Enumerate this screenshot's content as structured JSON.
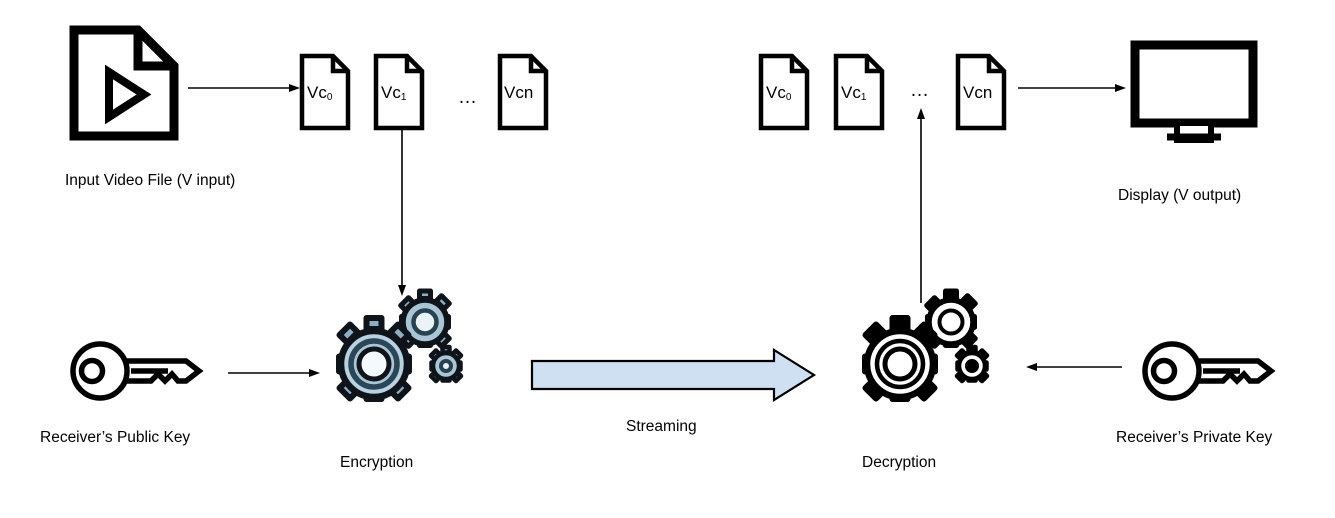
{
  "diagram": {
    "title_present": false,
    "colors": {
      "stroke": "#000000",
      "background": "#ffffff",
      "gear_fill_light": "#c3d7e4",
      "gear_fill_mid": "#9db8c9",
      "gear_fill_dark": "#6d8ca0",
      "stream_arrow_fill": "#cfe0f2",
      "stream_arrow_stroke": "#000000"
    },
    "nodes": {
      "input_video": {
        "icon": "video-file-icon",
        "label": "Input Video File (V input)"
      },
      "display": {
        "icon": "monitor-icon",
        "label": "Display (V output)"
      },
      "encryption": {
        "icon": "gears-icon",
        "label": "Encryption"
      },
      "decryption": {
        "icon": "gears-icon",
        "label": "Decryption"
      },
      "public_key": {
        "icon": "key-icon",
        "label": "Receiver’s Public Key"
      },
      "private_key": {
        "icon": "key-icon",
        "label": "Receiver’s Private Key"
      },
      "streaming": {
        "label": "Streaming"
      }
    },
    "chunks_left": [
      {
        "prefix": "Vc",
        "sub": "0",
        "text": "Vc0"
      },
      {
        "prefix": "Vc",
        "sub": "1",
        "text": "Vc1"
      },
      {
        "prefix": "",
        "sub": "",
        "text": "…"
      },
      {
        "prefix": "Vcn",
        "sub": "",
        "text": "Vcn"
      }
    ],
    "chunks_right": [
      {
        "prefix": "Vc",
        "sub": "0",
        "text": "Vc0"
      },
      {
        "prefix": "Vc",
        "sub": "1",
        "text": "Vc1"
      },
      {
        "prefix": "",
        "sub": "",
        "text": "…"
      },
      {
        "prefix": "Vcn",
        "sub": "",
        "text": "Vcn"
      }
    ],
    "ellipsis": "…",
    "arrows": [
      {
        "name": "video-to-chunks",
        "direction": "right"
      },
      {
        "name": "chunks-to-encryption",
        "direction": "down"
      },
      {
        "name": "public-key-to-encryption",
        "direction": "right"
      },
      {
        "name": "encryption-to-decryption-streaming",
        "direction": "right"
      },
      {
        "name": "private-key-to-decryption",
        "direction": "left"
      },
      {
        "name": "decryption-to-chunks",
        "direction": "up"
      },
      {
        "name": "chunks-to-display",
        "direction": "right"
      }
    ]
  }
}
